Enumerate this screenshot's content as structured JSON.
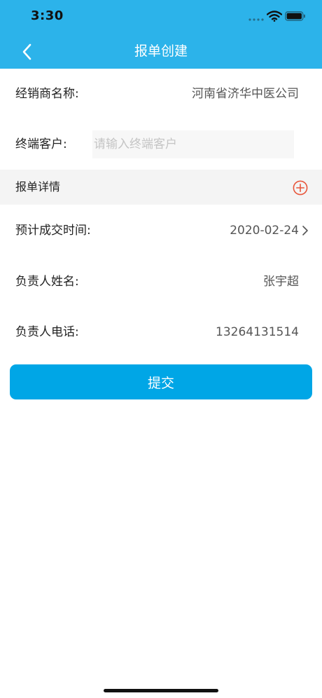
{
  "status_bar": {
    "time": "3:30"
  },
  "nav": {
    "title": "报单创建"
  },
  "form": {
    "dealer": {
      "label": "经销商名称:",
      "value": "河南省济华中医公司"
    },
    "terminal_customer": {
      "label": "终端客户:",
      "placeholder": "请输入终端客户",
      "value": ""
    },
    "details_section": {
      "title": "报单详情"
    },
    "expected_close_date": {
      "label": "预计成交时间:",
      "value": "2020-02-24"
    },
    "owner_name": {
      "label": "负责人姓名:",
      "value": "张宇超"
    },
    "owner_phone": {
      "label": "负责人电话:",
      "value": "13264131514"
    }
  },
  "actions": {
    "submit_label": "提交"
  },
  "colors": {
    "nav_bar": "#2cb3ea",
    "submit_button": "#00a6e6",
    "add_icon": "#e8553a"
  }
}
